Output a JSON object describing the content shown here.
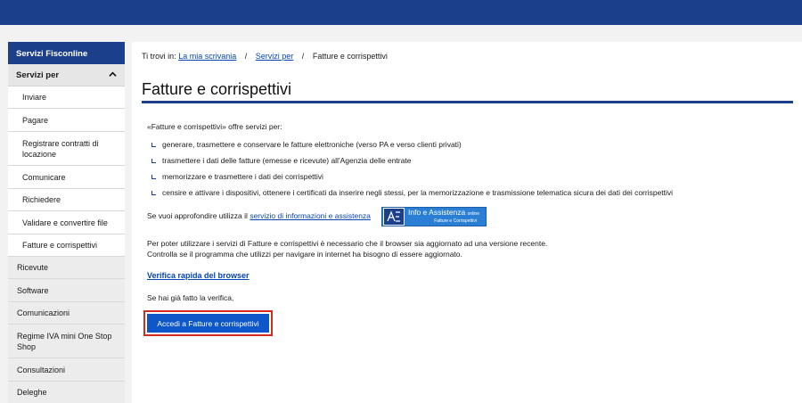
{
  "sidebar": {
    "header": "Servizi Fisconline",
    "section": "Servizi per",
    "section_icon": "chevron-up-icon",
    "subitems": [
      "Inviare",
      "Pagare",
      "Registrare contratti di locazione",
      "Comunicare",
      "Richiedere",
      "Validare e convertire file",
      "Fatture e corrispettivi"
    ],
    "items": [
      "Ricevute",
      "Software",
      "Comunicazioni",
      "Regime IVA mini One Stop Shop",
      "Consultazioni",
      "Deleghe"
    ]
  },
  "breadcrumb": {
    "prefix": "Ti trovi in:",
    "link1": "La mia scrivania",
    "link2": "Servizi per",
    "separator": "/",
    "current": "Fatture e corrispettivi"
  },
  "page": {
    "title": "Fatture e corrispettivi",
    "intro": "«Fatture e corrispettivi» offre servizi per:",
    "bullets": [
      "generare, trasmettere e conservare le fatture elettroniche (verso PA e verso clienti privati)",
      "trasmettere i dati delle fatture (emesse e ricevute) all'Agenzia delle entrate",
      "memorizzare e trasmettere i dati dei corrispettivi",
      "censire e attivare i dispositivi, ottenere i certificati da inserire negli stessi, per la memorizzazione e trasmissione telematica sicura dei dati dei corrispettivi"
    ],
    "info_text": "Se vuoi approfondire utilizza il",
    "info_link": "servizio di informazioni e assistenza",
    "badge_title": "Info e Assistenza",
    "badge_online": "online",
    "badge_sub": "Fatture e Corrispettivi",
    "browser_line1": "Per poter utilizzare i servizi di Fatture e corrispettivi è necessario che il browser sia aggiornato ad una versione recente.",
    "browser_line2": "Controlla se il programma che utilizzi per navigare in internet ha bisogno di essere aggiornato.",
    "verify_link": "Verifica rapida del browser",
    "done_text": "Se hai già fatto la verifica,",
    "cta_label": "Accedi a Fatture e corrispettivi"
  },
  "colors": {
    "brand_blue": "#1c3f8c",
    "link": "#0645b4",
    "cta": "#0d57c9",
    "highlight": "#d42a1f"
  }
}
